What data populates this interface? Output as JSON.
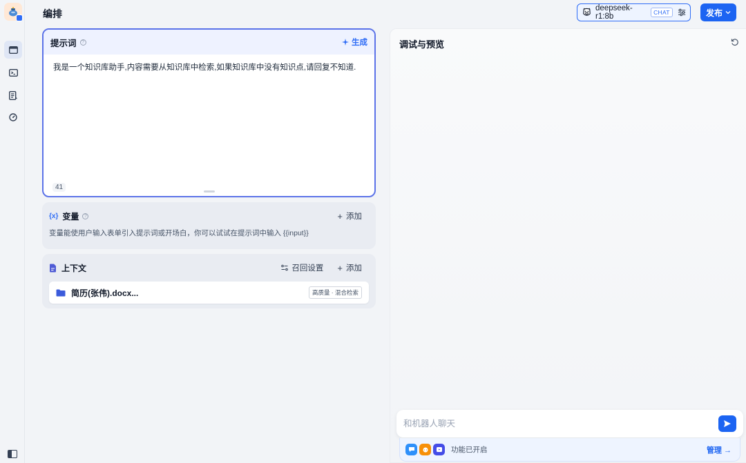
{
  "header": {
    "title": "编排",
    "model": {
      "name": "deepseek-r1:8b",
      "tag": "CHAT"
    },
    "publish_label": "发布"
  },
  "prompt": {
    "title": "提示词",
    "generate_label": "生成",
    "text": "我是一个知识库助手,内容需要从知识库中检索,如果知识库中没有知识点,请回复不知道.",
    "char_count": "41"
  },
  "variables": {
    "icon_text": "{x}",
    "title": "变量",
    "add_label": "添加",
    "description": "变量能使用户输入表单引入提示词或开场白，你可以试试在提示词中输入 {{input}}"
  },
  "context": {
    "title": "上下文",
    "recall_label": "召回设置",
    "add_label": "添加",
    "files": [
      {
        "name": "简历(张伟).docx...",
        "tag": "高质量 · 混合检索"
      }
    ]
  },
  "preview": {
    "title": "调试与预览",
    "chat_placeholder": "和机器人聊天",
    "features_label": "功能已开启",
    "manage_label": "管理 →"
  },
  "colors": {
    "accent": "#1c64f2",
    "prompt_border": "#5b72e8"
  }
}
